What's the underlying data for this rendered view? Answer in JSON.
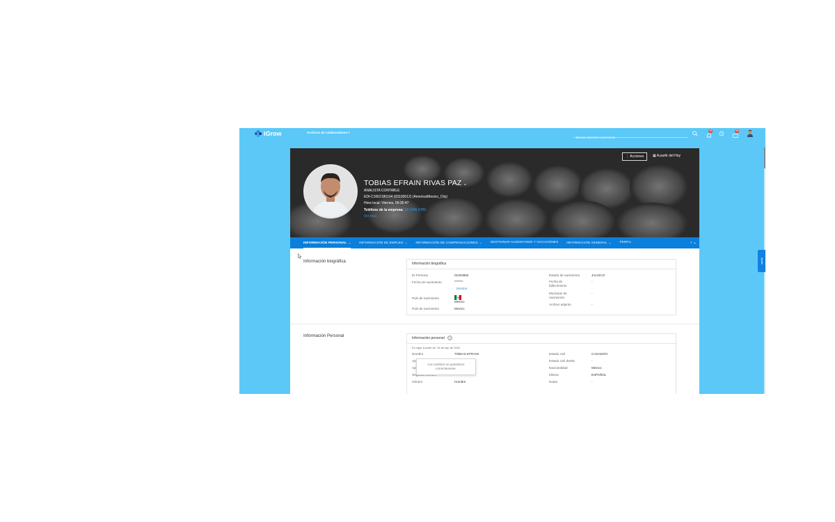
{
  "topbar": {
    "logo_text": "iGrow",
    "employee_files_label": "Archivos de colaboradores",
    "search_placeholder": "Buscar acciones o personas",
    "notifications_count": "10",
    "messages_count": "20",
    "icons": [
      "search-icon",
      "bell-icon",
      "clock-icon",
      "chat-icon",
      "user-avatar-icon"
    ]
  },
  "side_tab": {
    "label": "Ayuda"
  },
  "header": {
    "name": "TOBIAS EFRAIN RIVAS PAZ",
    "title": "ANALISTA CONTABLE",
    "identifier": "EDI-C1652180104 (03100012) (America/Mexico_City)",
    "local_time": "Hora local: Viernes, 09:35:47",
    "phone_label": "Teléfono de la empresa:",
    "phone_value": "33 1245 6789",
    "extra_link": "Ver más",
    "actions_button": "Acciones",
    "date_button": "A partir del Hoy"
  },
  "tabs": [
    {
      "label": "INFORMACIÓN PERSONAL",
      "active": true
    },
    {
      "label": "INFORMACIÓN DE EMPLEO",
      "active": false
    },
    {
      "label": "INFORMACIÓN DE COMPENSACIONES",
      "active": false
    },
    {
      "label": "GESTIONAR AUSENTISMO Y VACACIONES",
      "active": false
    },
    {
      "label": "INFORMACIÓN GENERAL",
      "active": false
    },
    {
      "label": "PERFIL",
      "active": false
    }
  ],
  "bio": {
    "section_title": "Información biográfica",
    "card_title": "Información biográfica",
    "left": [
      {
        "label": "ID Persona",
        "value": "01003984"
      },
      {
        "label": "Fecha de nacimiento",
        "value": "*******"
      },
      {
        "label": "País de nacimiento",
        "value": "Mexico"
      },
      {
        "label": "País de nacimiento",
        "value": "Mexico"
      }
    ],
    "show_link": "Mostrar",
    "right": [
      {
        "label": "Estado de nacimiento",
        "value": "JALISCO"
      },
      {
        "label": "Fecha de fallecimiento",
        "value": "-"
      },
      {
        "label": "Municipio de nacimiento",
        "value": "-"
      },
      {
        "label": "Archivo adjunto",
        "value": "-"
      }
    ]
  },
  "personal": {
    "section_title": "Información Personal",
    "card_title": "Información personal",
    "effective": "En vigor a partir de: 16 de sep de 2022",
    "left": [
      {
        "label": "Nombre",
        "value": "TOBIAS EFRAIN"
      },
      {
        "label": "Apellido paterno",
        "value": "RIVAS"
      },
      {
        "label": "Apellido materno",
        "value": "PAZ"
      },
      {
        "label": "Segundo nombre",
        "value": "-"
      },
      {
        "label": "Género",
        "value": "Hombre"
      }
    ],
    "right": [
      {
        "label": "Estado civil",
        "value": "CASADO/A"
      },
      {
        "label": "Estado civil desde",
        "value": "-"
      },
      {
        "label": "Nacionalidad",
        "value": "México"
      },
      {
        "label": "Idioma",
        "value": "ESPAÑOL"
      },
      {
        "label": "Notas",
        "value": "-"
      }
    ]
  },
  "toast": {
    "line1": "Los cambios se guardaron",
    "line2": "correctamente."
  },
  "colors": {
    "shell": "#5bc8f8",
    "tabs": "#0b7fdc",
    "badge": "#e5352c"
  }
}
